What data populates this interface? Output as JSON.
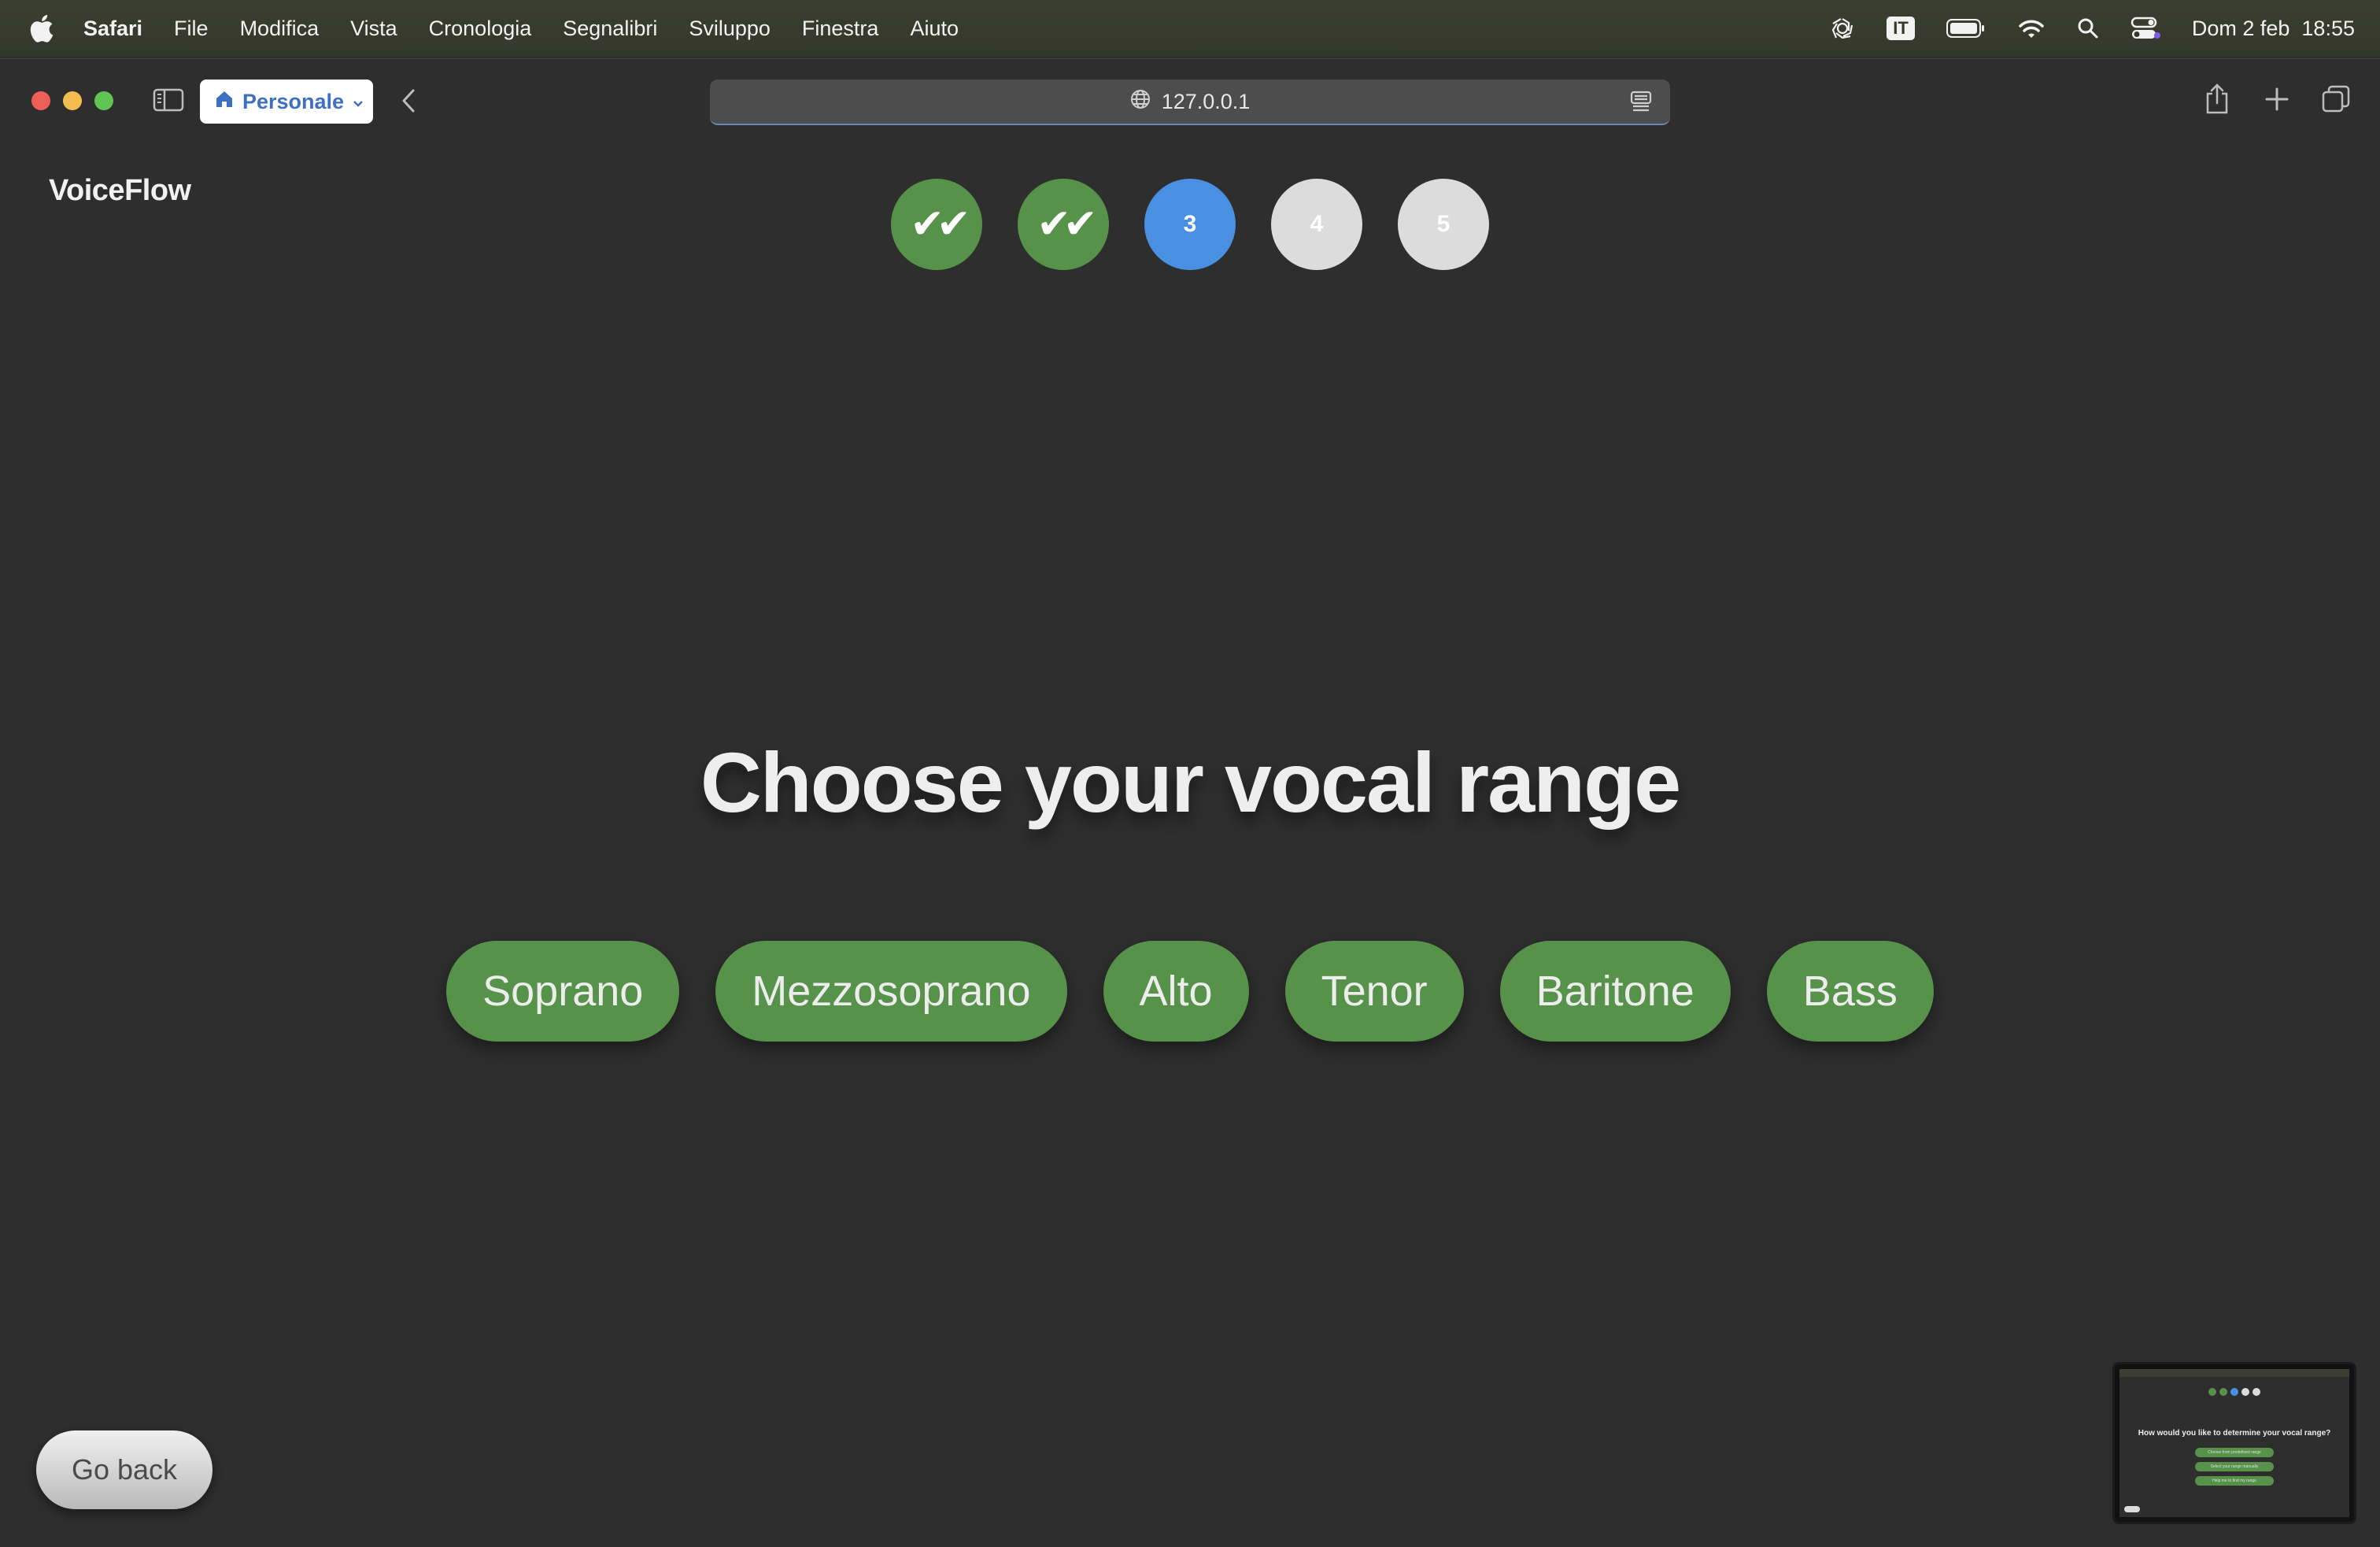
{
  "menubar": {
    "app_name": "Safari",
    "items": [
      "File",
      "Modifica",
      "Vista",
      "Cronologia",
      "Segnalibri",
      "Sviluppo",
      "Finestra",
      "Aiuto"
    ],
    "input_language": "IT",
    "datetime": "Dom 2 feb  18:55"
  },
  "browser": {
    "profile_label": "Personale",
    "url": "127.0.0.1"
  },
  "app": {
    "brand": "VoiceFlow",
    "steps": [
      {
        "label": "✔✔",
        "state": "done"
      },
      {
        "label": "✔✔",
        "state": "done"
      },
      {
        "label": "3",
        "state": "active"
      },
      {
        "label": "4",
        "state": "todo"
      },
      {
        "label": "5",
        "state": "todo"
      }
    ],
    "heading": "Choose your vocal range",
    "ranges": [
      "Soprano",
      "Mezzosoprano",
      "Alto",
      "Tenor",
      "Baritone",
      "Bass"
    ],
    "go_back_label": "Go back"
  },
  "thumbnail": {
    "title": "How would you like to determine your vocal range?",
    "options": [
      "Choose from predefined range",
      "Select your range manually",
      "Help me to find my range"
    ]
  },
  "colors": {
    "step_done": "#57924a",
    "step_active": "#4a90e2",
    "step_todo": "#dcdcdc",
    "range_button": "#57924a",
    "page_background": "#2e2e2e"
  }
}
